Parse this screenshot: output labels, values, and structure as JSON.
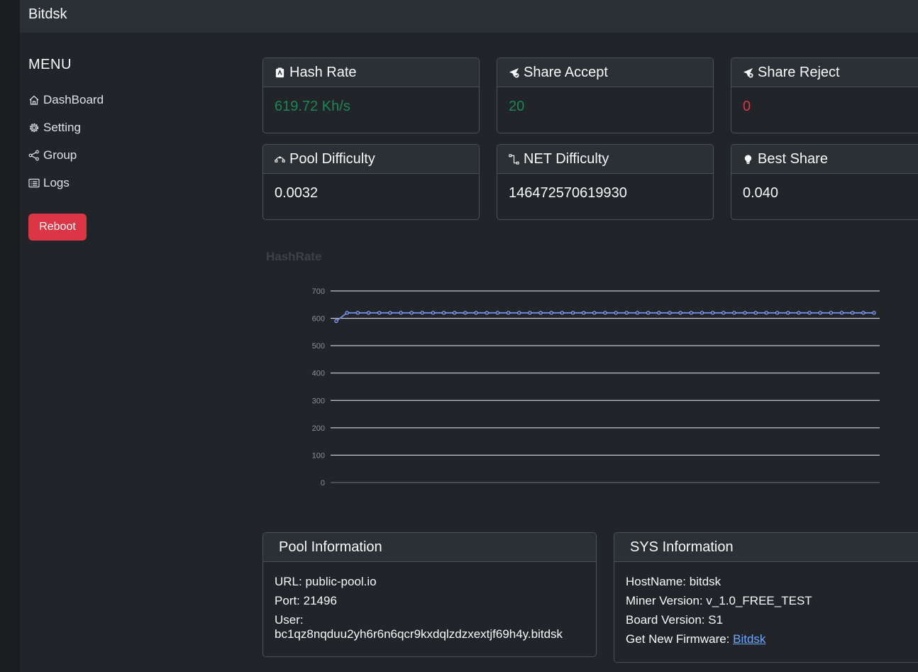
{
  "brand": "Bitdsk",
  "menu": {
    "title": "MENU",
    "items": [
      {
        "label": "DashBoard",
        "icon": "house-icon"
      },
      {
        "label": "Setting",
        "icon": "gear-icon"
      },
      {
        "label": "Group",
        "icon": "share-icon"
      },
      {
        "label": "Logs",
        "icon": "log-icon"
      }
    ],
    "reboot_label": "Reboot"
  },
  "stats": {
    "hash_rate": {
      "label": "Hash Rate",
      "value": "619.72 Kh/s"
    },
    "share_accept": {
      "label": "Share Accept",
      "value": "20"
    },
    "share_reject": {
      "label": "Share Reject",
      "value": "0"
    },
    "pool_difficulty": {
      "label": "Pool Difficulty",
      "value": "0.0032"
    },
    "net_difficulty": {
      "label": "NET Difficulty",
      "value": "146472570619930"
    },
    "best_share": {
      "label": "Best Share",
      "value": "0.040"
    }
  },
  "colors": {
    "accent_green": "#198754",
    "danger_red": "#dc3545",
    "line_blue": "#6f86d6"
  },
  "chart_data": {
    "type": "line",
    "title": "HashRate",
    "xlabel": "",
    "ylabel": "",
    "ylim": [
      0,
      700
    ],
    "yticks": [
      0,
      100,
      200,
      300,
      400,
      500,
      600,
      700
    ],
    "grid": true,
    "series": [
      {
        "values": [
          590,
          620,
          620,
          620,
          620,
          620,
          620,
          620,
          620,
          620,
          620,
          620,
          620,
          620,
          620,
          620,
          620,
          620,
          620,
          620,
          620,
          620,
          620,
          620,
          620,
          620,
          620,
          620,
          620,
          620,
          620,
          620,
          620,
          620,
          620,
          620,
          620,
          620,
          620,
          620,
          620,
          620,
          620,
          620,
          620,
          620,
          620,
          620,
          620,
          620,
          620
        ]
      }
    ]
  },
  "pool_info": {
    "title": "Pool Information",
    "url": "URL: public-pool.io",
    "port": "Port: 21496",
    "user_label": "User:",
    "user_value": "bc1qz8nqduu2yh6r6n6qcr9kxdqlzdzxextjf69h4y.bitdsk"
  },
  "sys_info": {
    "title": "SYS Information",
    "hostname": "HostName: bitdsk",
    "miner_version": "Miner Version: v_1.0_FREE_TEST",
    "board_version": "Board Version: S1",
    "firmware_label": "Get New Firmware: ",
    "firmware_link": "Bitdsk"
  }
}
